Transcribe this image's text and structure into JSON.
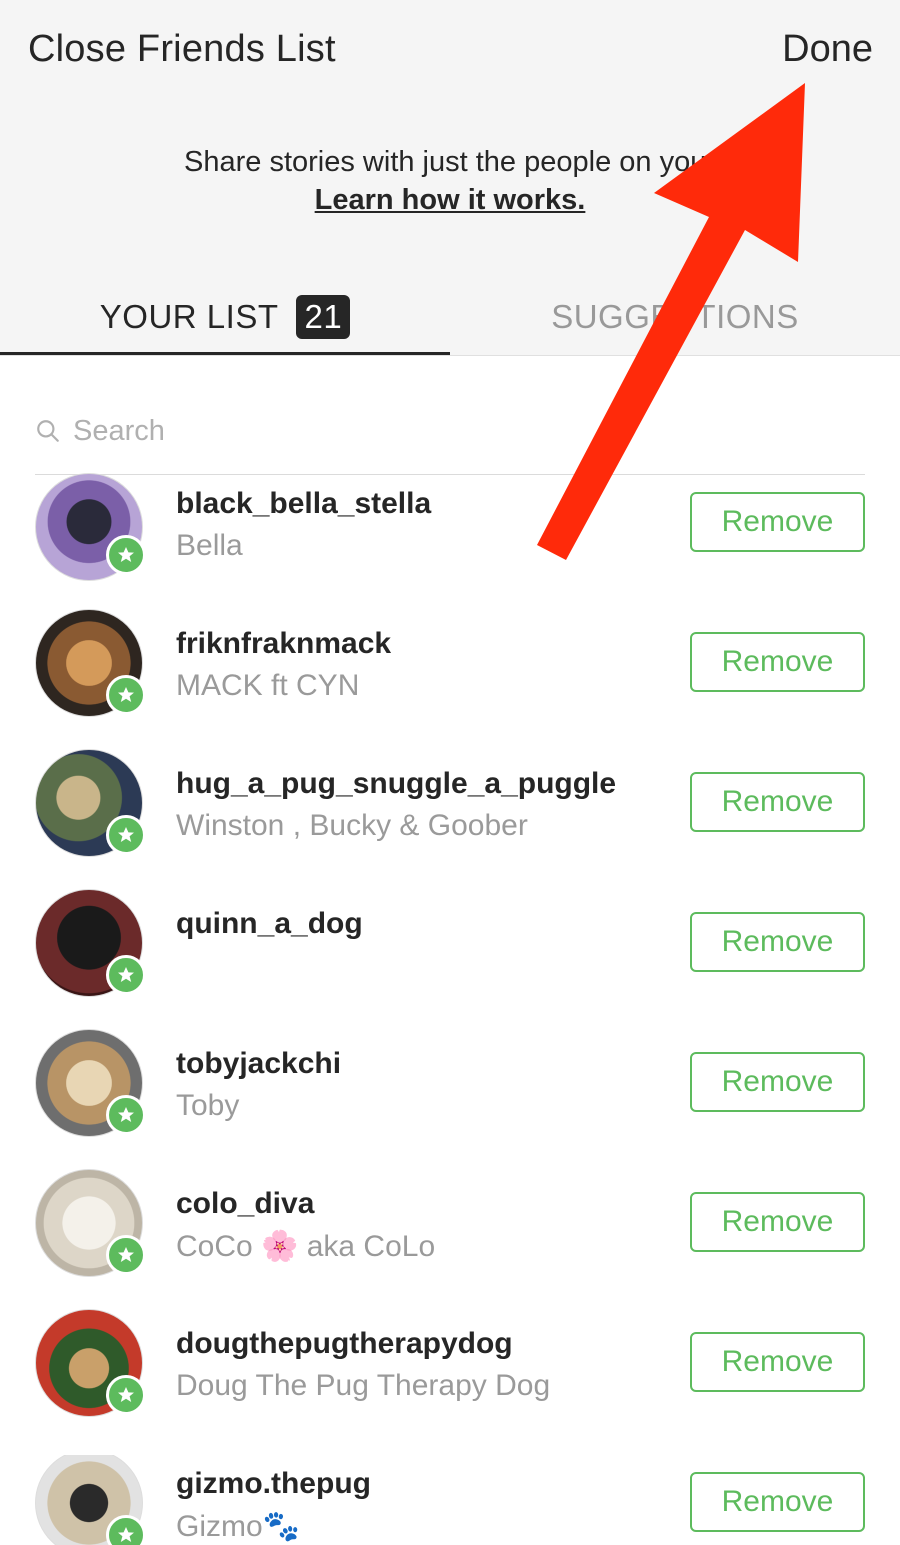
{
  "header": {
    "title": "Close Friends List",
    "done_label": "Done",
    "description": "Share stories with just the people on your",
    "learn_link": "Learn how it works."
  },
  "tabs": {
    "your_list_label": "YOUR LIST",
    "your_list_count": "21",
    "suggestions_label": "SUGGESTIONS"
  },
  "search": {
    "placeholder": "Search",
    "value": ""
  },
  "friends": [
    {
      "username": "black_bella_stella",
      "name": "Bella",
      "action": "Remove"
    },
    {
      "username": "friknfraknmack",
      "name": "MACK ft CYN",
      "action": "Remove"
    },
    {
      "username": "hug_a_pug_snuggle_a_puggle",
      "name": "Winston , Bucky & Goober",
      "action": "Remove"
    },
    {
      "username": "quinn_a_dog",
      "name": "",
      "action": "Remove"
    },
    {
      "username": "tobyjackchi",
      "name": "Toby",
      "action": "Remove"
    },
    {
      "username": "colo_diva",
      "name": "CoCo 🌸 aka CoLo",
      "action": "Remove"
    },
    {
      "username": "dougthepugtherapydog",
      "name": "Doug The Pug Therapy Dog",
      "action": "Remove"
    },
    {
      "username": "gizmo.thepug",
      "name": "Gizmo🐾",
      "action": "Remove"
    }
  ],
  "colors": {
    "accent_green": "#5dbb5d",
    "annotation_arrow": "#ff2a0a",
    "header_bg": "#f5f5f5"
  },
  "icons": {
    "search": "search-icon",
    "badge": "close-friend-star-icon",
    "annotation": "red-arrow-annotation"
  }
}
